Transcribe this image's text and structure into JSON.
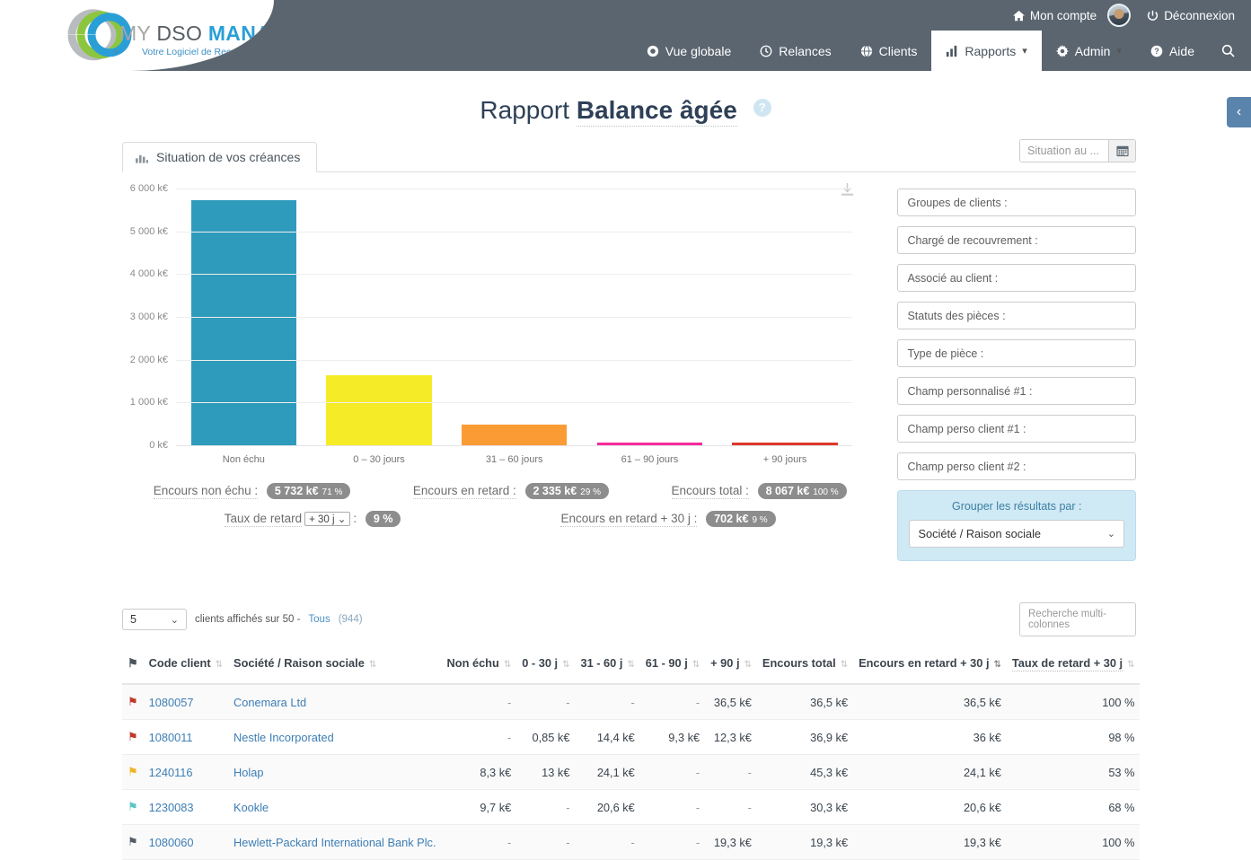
{
  "brand": {
    "my": "MY",
    "dso": "DSO",
    "manager": "MANAGER",
    "tagline": "Votre Logiciel de Recouvrement",
    "arrows": "›››"
  },
  "header": {
    "account_label": "Mon compte",
    "logout_label": "Déconnexion",
    "nav": [
      {
        "label": "Vue globale",
        "icon": "eye-icon",
        "active": false
      },
      {
        "label": "Relances",
        "icon": "clock-icon",
        "active": false
      },
      {
        "label": "Clients",
        "icon": "globe-icon",
        "active": false
      },
      {
        "label": "Rapports",
        "icon": "bar-chart-icon",
        "active": true,
        "caret": "▾"
      },
      {
        "label": "Admin",
        "icon": "gear-icon",
        "active": false,
        "caret": "▾"
      },
      {
        "label": "Aide",
        "icon": "question-icon",
        "active": false
      },
      {
        "label": "",
        "icon": "search-icon",
        "active": false
      }
    ]
  },
  "page": {
    "title_prefix": "Rapport",
    "title_strong": "Balance âgée",
    "help": "?",
    "collapse_icon": "‹"
  },
  "tab": {
    "label": "Situation de vos créances"
  },
  "date_filter": {
    "placeholder": "Situation au ...",
    "value": "",
    "calendar_icon": "calendar-icon"
  },
  "chart_data": {
    "type": "bar",
    "title": "Situation de vos créances",
    "xlabel": "",
    "ylabel": "k€",
    "categories": [
      "Non échu",
      "0 – 30 jours",
      "31 – 60 jours",
      "61 – 90 jours",
      "+ 90 jours"
    ],
    "values": [
      5732,
      1633,
      492,
      53,
      47
    ],
    "colors": [
      "#2f9bbc",
      "#f5ec27",
      "#fa9c33",
      "#f72a9c",
      "#e0372a"
    ],
    "ylim": [
      0,
      6000
    ],
    "yticks": [
      0,
      1000,
      2000,
      3000,
      4000,
      5000,
      6000
    ],
    "ytick_labels": [
      "0 k€",
      "1 000 k€",
      "2 000 k€",
      "3 000 k€",
      "4 000 k€",
      "5 000 k€",
      "6 000 k€"
    ],
    "grid": true,
    "legend": "none"
  },
  "download_icon": "download-icon",
  "stats": {
    "non_echu": {
      "label": "Encours non échu :",
      "value": "5 732 k€",
      "pct": "71 %"
    },
    "en_retard": {
      "label": "Encours en retard :",
      "value": "2 335 k€",
      "pct": "29 %"
    },
    "total": {
      "label": "Encours total :",
      "value": "8 067 k€",
      "pct": "100 %"
    },
    "taux_retard": {
      "label": "Taux de retard",
      "select": "+ 30 j",
      "sep": ":",
      "value": "9 %"
    },
    "retard_30": {
      "label": "Encours en retard + 30 j :",
      "value": "702 k€",
      "pct": "9 %"
    }
  },
  "filters": {
    "items": [
      "Groupes de clients :",
      "Chargé de recouvrement :",
      "Associé au client :",
      "Statuts des pièces :",
      "Type de pièce :",
      "Champ personnalisé #1 :",
      "Champ perso client #1 :",
      "Champ perso client #2 :"
    ],
    "group_title": "Grouper les résultats par :",
    "group_value": "Société / Raison sociale",
    "group_caret": "⌄"
  },
  "table": {
    "rows_per_page": "5",
    "rows_caret": "⌄",
    "info_text": "clients affichés sur 50 -",
    "all_link": "Tous",
    "all_count": "(944)",
    "search_placeholder": "Recherche multi-colonnes",
    "columns": [
      {
        "label": "",
        "key": "flag",
        "align": "left",
        "sort": false
      },
      {
        "label": "Code client",
        "key": "code",
        "align": "left",
        "sort": true
      },
      {
        "label": "Société / Raison sociale",
        "key": "name",
        "align": "left",
        "sort": true
      },
      {
        "label": "Non échu",
        "key": "non_echu",
        "align": "right",
        "sort": true
      },
      {
        "label": "0 - 30 j",
        "key": "d0_30",
        "align": "right",
        "sort": true
      },
      {
        "label": "31 - 60 j",
        "key": "d31_60",
        "align": "right",
        "sort": true
      },
      {
        "label": "61 - 90 j",
        "key": "d61_90",
        "align": "right",
        "sort": true
      },
      {
        "label": "+ 90 j",
        "key": "d90plus",
        "align": "right",
        "sort": true
      },
      {
        "label": "Encours total",
        "key": "total",
        "align": "right",
        "sort": true
      },
      {
        "label": "Encours en retard + 30 j",
        "key": "retard30",
        "align": "right",
        "sort": true,
        "sort_active": true
      },
      {
        "label": "Taux de retard + 30 j",
        "key": "taux",
        "align": "right",
        "sort": true,
        "dotted": true
      }
    ],
    "rows": [
      {
        "flag_color": "#c0392b",
        "code": "1080057",
        "name": "Conemara Ltd",
        "non_echu": "-",
        "d0_30": "-",
        "d31_60": "-",
        "d61_90": "-",
        "d90plus": "36,5 k€",
        "total": "36,5 k€",
        "retard30": "36,5 k€",
        "taux": "100 %"
      },
      {
        "flag_color": "#c0392b",
        "code": "1080011",
        "name": "Nestle Incorporated",
        "non_echu": "-",
        "d0_30": "0,85 k€",
        "d31_60": "14,4 k€",
        "d61_90": "9,3 k€",
        "d90plus": "12,3 k€",
        "total": "36,9 k€",
        "retard30": "36 k€",
        "taux": "98 %"
      },
      {
        "flag_color": "#f0b429",
        "code": "1240116",
        "name": "Holap",
        "non_echu": "8,3 k€",
        "d0_30": "13 k€",
        "d31_60": "24,1 k€",
        "d61_90": "-",
        "d90plus": "-",
        "total": "45,3 k€",
        "retard30": "24,1 k€",
        "taux": "53 %"
      },
      {
        "flag_color": "#5bc6c6",
        "code": "1230083",
        "name": "Kookle",
        "non_echu": "9,7 k€",
        "d0_30": "-",
        "d31_60": "20,6 k€",
        "d61_90": "-",
        "d90plus": "-",
        "total": "30,3 k€",
        "retard30": "20,6 k€",
        "taux": "68 %"
      },
      {
        "flag_color": "#555e66",
        "code": "1080060",
        "name": "Hewlett-Packard International Bank Plc.",
        "non_echu": "-",
        "d0_30": "-",
        "d31_60": "-",
        "d61_90": "-",
        "d90plus": "19,3 k€",
        "total": "19,3 k€",
        "retard30": "19,3 k€",
        "taux": "100 %"
      }
    ]
  }
}
